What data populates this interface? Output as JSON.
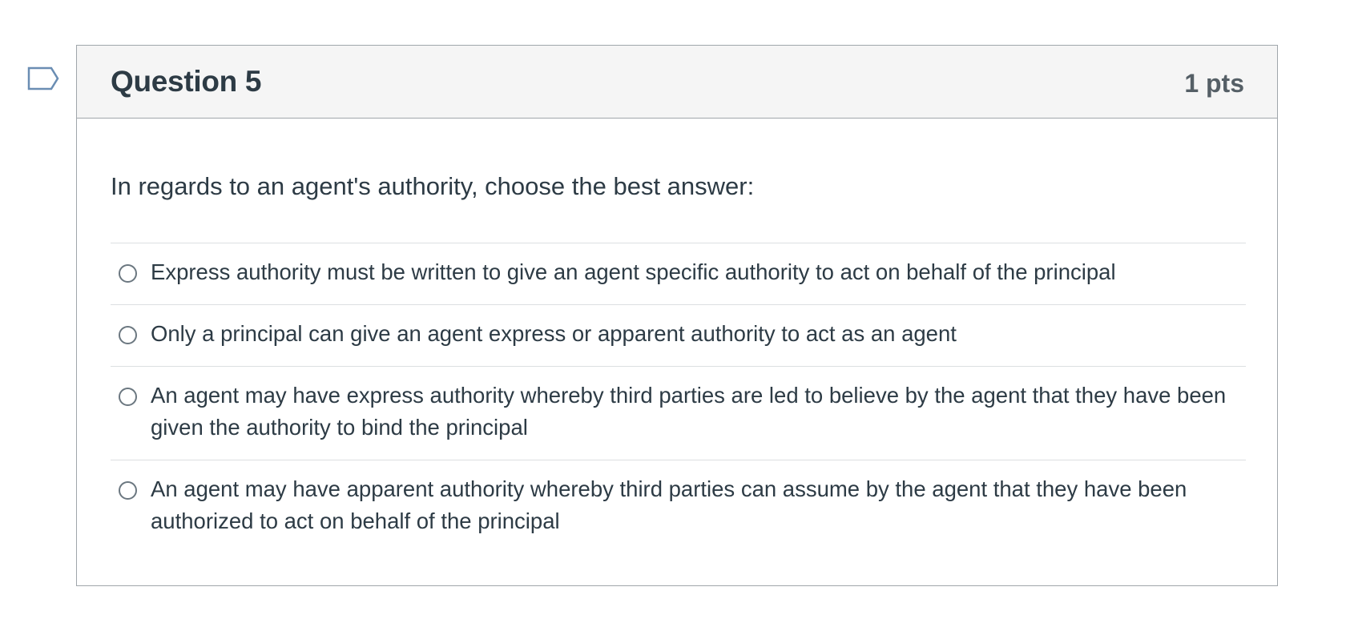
{
  "question": {
    "title": "Question 5",
    "points": "1 pts",
    "text": "In regards to an agent's authority, choose the best answer:",
    "answers": [
      {
        "label": "Express authority must be written to give an agent specific authority to act on behalf of the principal",
        "selected": false
      },
      {
        "label": "Only a principal can give an agent express or apparent authority to act as an agent",
        "selected": false
      },
      {
        "label": "An agent may have express authority whereby third parties are led to believe by the agent that they have been given the authority to bind the principal",
        "selected": false
      },
      {
        "label": "An agent may have apparent authority whereby third parties can assume by the agent that they have been authorized to act on behalf of the principal",
        "selected": false
      }
    ]
  },
  "flag": {
    "icon": "flag-question-icon",
    "color": "#6a8db3"
  },
  "colors": {
    "header_bg": "#f5f5f5",
    "border": "#a0a6ab",
    "text": "#2d3b45"
  }
}
